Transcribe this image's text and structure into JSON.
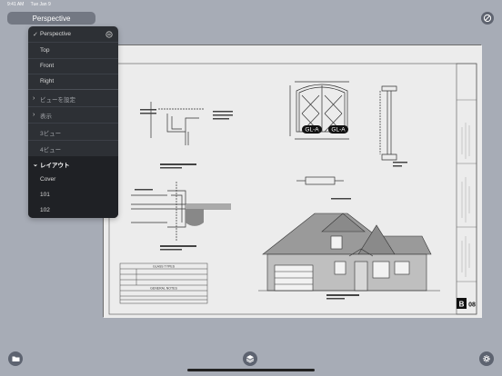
{
  "status_bar": {
    "time": "9:41 AM",
    "date": "Tue Jan 9"
  },
  "view_selector": {
    "label": "Perspective"
  },
  "menu": {
    "views": [
      {
        "label": "Perspective",
        "checked": true
      },
      {
        "label": "Top"
      },
      {
        "label": "Front"
      },
      {
        "label": "Right"
      }
    ],
    "view_settings": "ビューを設定",
    "display": "表示",
    "three_view": "3ビュー",
    "four_view": "4ビュー",
    "layout": {
      "label": "レイアウト",
      "expanded": true
    },
    "layout_items": [
      "Cover",
      "101",
      "102"
    ]
  },
  "drawing": {
    "window_tags": [
      "GL-A",
      "GL-A"
    ],
    "title_block": {
      "sheet_letter": "B",
      "sheet_number": "08"
    },
    "table_headings": [
      "GLASS TYPES",
      "GENERAL NOTES"
    ],
    "detail_titles": [
      "DOOR 113 HEAD DETAILS",
      "WINDOW SILL",
      "DOOR 113 JAMB DETAILS",
      "South Elevation - Front"
    ]
  },
  "toolbar": {
    "icons": [
      "folder-icon",
      "layers-icon",
      "settings-gear-icon"
    ]
  },
  "colors": {
    "background": "#a7acb6",
    "menu": "#2d3035",
    "paper": "#e6e6e6"
  }
}
